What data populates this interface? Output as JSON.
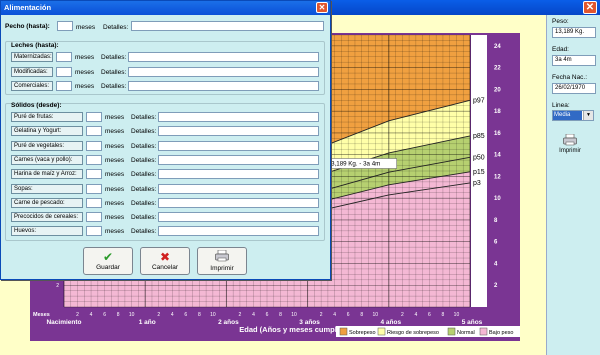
{
  "main": {
    "close_glyph": "✕",
    "peso_label": "Peso:",
    "peso_value": "13,189 Kg.",
    "edad_label": "Edad:",
    "edad_value": "3a 4m",
    "fecha_label": "Fecha Nac.:",
    "fecha_value": "26/02/1970",
    "linea_label": "Linea:",
    "linea_value": "Media",
    "print_label": "Imprimir"
  },
  "dialog": {
    "title": "Alimentación",
    "close_glyph": "✕",
    "pecho": {
      "label": "Pecho (hasta):",
      "unit": "meses",
      "detalles": "Detalles:"
    },
    "leches": {
      "title": "Leches (hasta):",
      "unit": "meses",
      "detalles": "Detalles:",
      "items": [
        "Maternizadas:",
        "Modificadas:",
        "Comerciales:"
      ]
    },
    "solidos": {
      "title": "Sólidos (desde):",
      "unit": "meses",
      "detalles": "Detalles:",
      "items": [
        "Puré de frutas:",
        "Gelatina y Yogurt:",
        "Puré de vegetales:",
        "Carnes (vaca y pollo):",
        "Harina de maíz y Arroz:",
        "Sopas:",
        "Carne de pescado:",
        "Precocidos de cereales:",
        "Huevos:"
      ]
    },
    "buttons": {
      "save": "Guardar",
      "cancel": "Cancelar",
      "print": "Imprimir"
    }
  },
  "chart_data": {
    "type": "area",
    "xlabel": "Edad (Años y meses cumplidos)",
    "x_major": [
      "Nacimiento",
      "1 año",
      "2 años",
      "3 años",
      "4 años",
      "5 años"
    ],
    "x_minor": [
      "2",
      "4",
      "6",
      "8",
      "10"
    ],
    "x_unit_label": "Meses",
    "y_ticks": [
      2,
      4,
      6,
      8,
      10,
      12,
      14,
      16,
      18,
      20,
      22,
      24
    ],
    "ylim": [
      0,
      25
    ],
    "curves": [
      "p3",
      "p15",
      "p50",
      "p85",
      "p97"
    ],
    "bands": [
      {
        "name": "Sobrepeso",
        "color": "#f0a040"
      },
      {
        "name": "Riesgo de sobrepeso",
        "color": "#ffffa8"
      },
      {
        "name": "Normal",
        "color": "#b6d070"
      },
      {
        "name": "Bajo peso",
        "color": "#f4b8d4"
      }
    ],
    "point": {
      "age_months": 40,
      "weight_kg": 13.189,
      "label": "13,189 Kg.  -  3a 4m"
    }
  }
}
